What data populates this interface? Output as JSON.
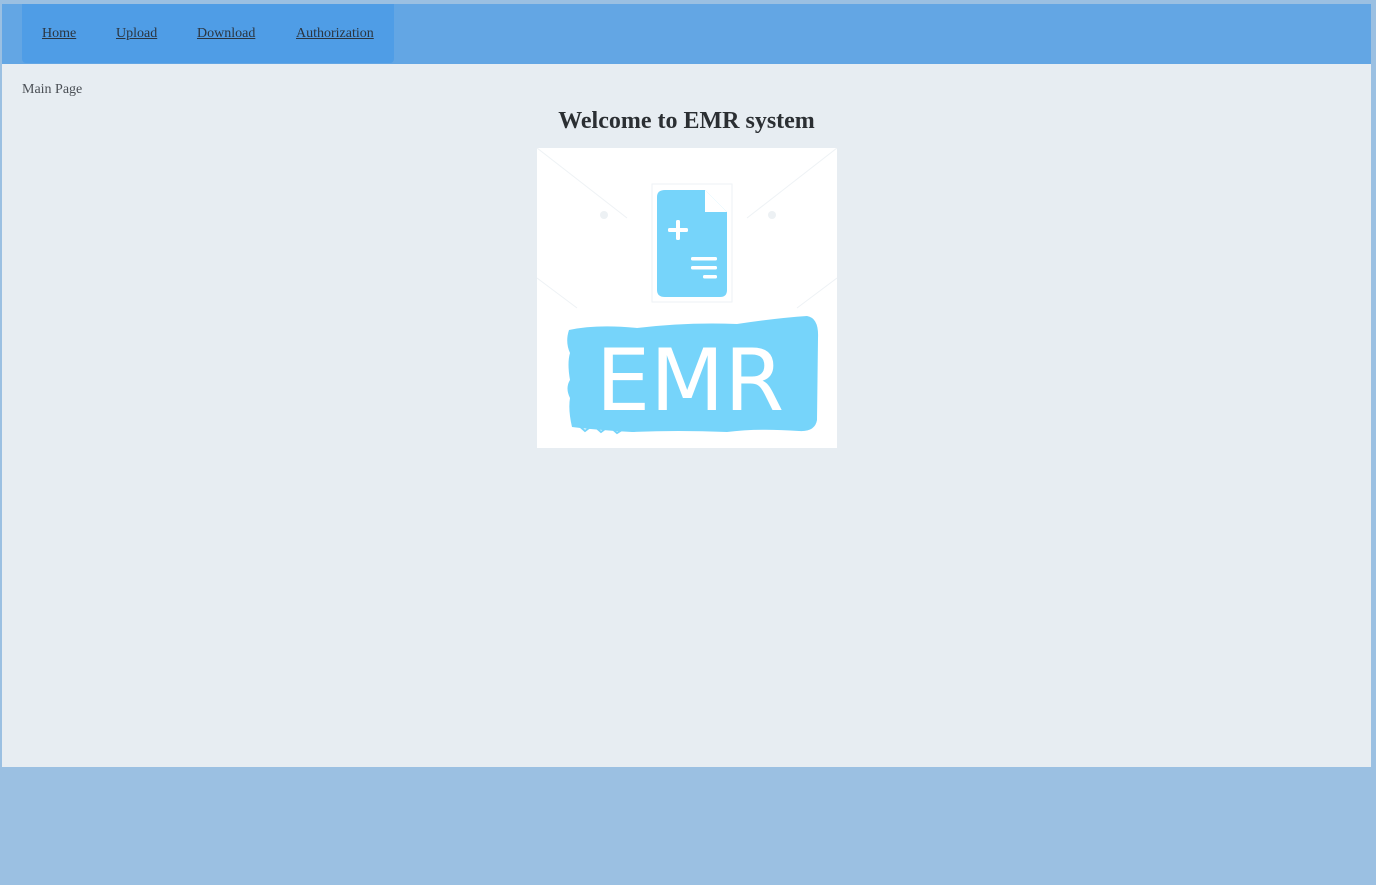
{
  "nav": {
    "items": [
      {
        "label": "Home"
      },
      {
        "label": "Upload"
      },
      {
        "label": "Download"
      },
      {
        "label": "Authorization"
      }
    ]
  },
  "breadcrumb": "Main Page",
  "page_title": "Welcome to EMR system",
  "logo": {
    "text": "EMR",
    "icon": "medical-document-plus-icon",
    "color": "#76d4fa"
  },
  "colors": {
    "page_background": "#9bc0e2",
    "topbar": "#63a6e4",
    "nav_background": "#4f9de6",
    "content_background": "#e7edf2"
  }
}
